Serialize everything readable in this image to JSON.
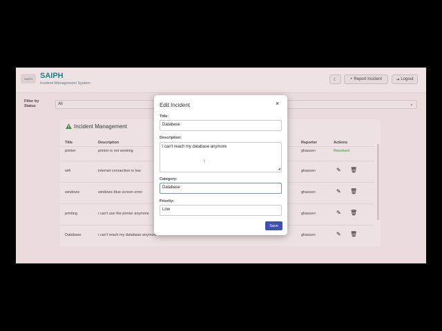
{
  "header": {
    "logo_text": "SAIPH",
    "brand": "SAIPH",
    "tagline": "Incident Management System",
    "report_label": "Report Incident",
    "logout_label": "Logout"
  },
  "filter": {
    "label": "Filter by Status",
    "value": "All"
  },
  "panel": {
    "title": "Incident Management",
    "columns": [
      "Title",
      "Description",
      "Reporter",
      "Actions"
    ],
    "rows": [
      {
        "title": "printer",
        "description": "printer is not working",
        "reporter": "ghassen",
        "action": "Resolved"
      },
      {
        "title": "wifi",
        "description": "internet connection is low",
        "reporter": "ghassen"
      },
      {
        "title": "windows",
        "description": "windows blue screen error",
        "reporter": "ghassen"
      },
      {
        "title": "printing",
        "description": "i can't use the printer anymore",
        "reporter": "ghassen"
      },
      {
        "title": "Database",
        "description": "i can't reach my database anymore",
        "reporter": "ghassen"
      }
    ]
  },
  "modal": {
    "title": "Edit Incident",
    "close_glyph": "×",
    "title_label": "Title:",
    "title_value": "Database",
    "description_label": "Description:",
    "description_value": "i can't reach my database anymore",
    "category_label": "Category:",
    "category_value": "Database",
    "priority_label": "Priority:",
    "priority_value": "Low",
    "save_label": "Save"
  },
  "colors": {
    "brand": "#0f8a96",
    "save": "#3f51b5",
    "resolved": "#2e9e3a"
  },
  "icons": [
    "moon-icon",
    "plus-icon",
    "logout-icon",
    "warning-icon",
    "edit-icon",
    "delete-icon",
    "close-icon",
    "chevron-down-icon"
  ]
}
